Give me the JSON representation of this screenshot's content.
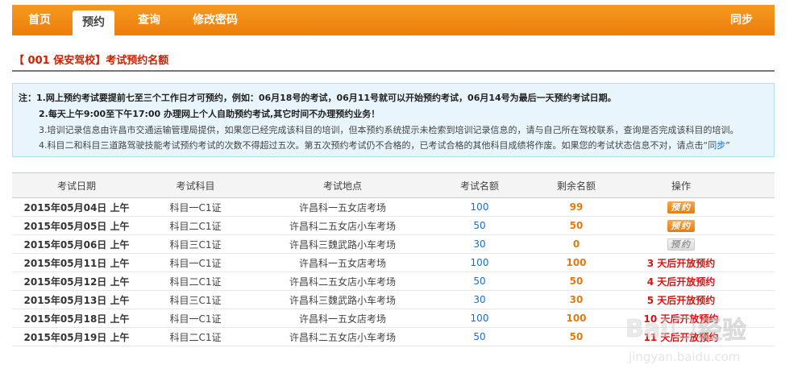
{
  "nav": {
    "items": [
      "首页",
      "预约",
      "查询",
      "修改密码"
    ],
    "active_index": 1,
    "sync_label": "同步"
  },
  "page_title": "【 001 保安驾校】考试预约名额",
  "notice": {
    "lines": [
      "注：1.网上预约考试要提前七至三个工作日才可预约，例如：06月18号的考试，06月11号就可以开始预约考试，06月14号为最后一天预约考试日期。",
      "2.每天上午9:00至下午17:00 办理网上个人自助预约考试,其它时间不办理预约业务！",
      "3.培训记录信息由许昌市交通运输管理局提供，如果您已经完成该科目的培训，但本预约系统提示未检索到培训记录信息的，请与自己所在驾校联系，查询是否完成该科目的培训。",
      "4.科目二和科目三道路驾驶技能考试预约考试的次数不得超过五次。第五次预约考试仍不合格的，已考试合格的其他科目成绩将作废。如果您的考试状态信息不对，请点击“"
    ],
    "sync_link": "同步",
    "line4_end": "”"
  },
  "table": {
    "headers": [
      "考试日期",
      "考试科目",
      "考试地点",
      "考试名额",
      "剩余名额",
      "操作"
    ],
    "rows": [
      {
        "date": "2015年05月04日 上午",
        "subject": "科目一C1证",
        "place": "许昌科一五女店考场",
        "quota": "100",
        "remaining": "99",
        "action": "预约",
        "action_type": "button"
      },
      {
        "date": "2015年05月05日 上午",
        "subject": "科目二C1证",
        "place": "许昌科二五女店小车考场",
        "quota": "50",
        "remaining": "50",
        "action": "预约",
        "action_type": "button"
      },
      {
        "date": "2015年05月06日 上午",
        "subject": "科目三C1证",
        "place": "许昌科三魏武路小车考场",
        "quota": "30",
        "remaining": "0",
        "action": "预约",
        "action_type": "disabled"
      },
      {
        "date": "2015年05月11日 上午",
        "subject": "科目一C1证",
        "place": "许昌科一五女店考场",
        "quota": "100",
        "remaining": "100",
        "action": "3 天后开放预约",
        "action_type": "status"
      },
      {
        "date": "2015年05月12日 上午",
        "subject": "科目二C1证",
        "place": "许昌科二五女店小车考场",
        "quota": "50",
        "remaining": "50",
        "action": "4 天后开放预约",
        "action_type": "status"
      },
      {
        "date": "2015年05月13日 上午",
        "subject": "科目三C1证",
        "place": "许昌科三魏武路小车考场",
        "quota": "30",
        "remaining": "30",
        "action": "5 天后开放预约",
        "action_type": "status"
      },
      {
        "date": "2015年05月18日 上午",
        "subject": "科目一C1证",
        "place": "许昌科一五女店考场",
        "quota": "100",
        "remaining": "100",
        "action": "10 天后开放预约",
        "action_type": "status"
      },
      {
        "date": "2015年05月19日 上午",
        "subject": "科目二C1证",
        "place": "许昌科二五女店小车考场",
        "quota": "50",
        "remaining": "50",
        "action": "11 天后开放预约",
        "action_type": "status"
      }
    ]
  },
  "watermark": {
    "brand": "Bai",
    "name": "经验",
    "url": "jingyan.baidu.com"
  },
  "colors": {
    "nav_orange": "#ee7d0b",
    "title_red": "#cc2200",
    "link_blue": "#1a66c9",
    "status_red": "#dd1111"
  }
}
